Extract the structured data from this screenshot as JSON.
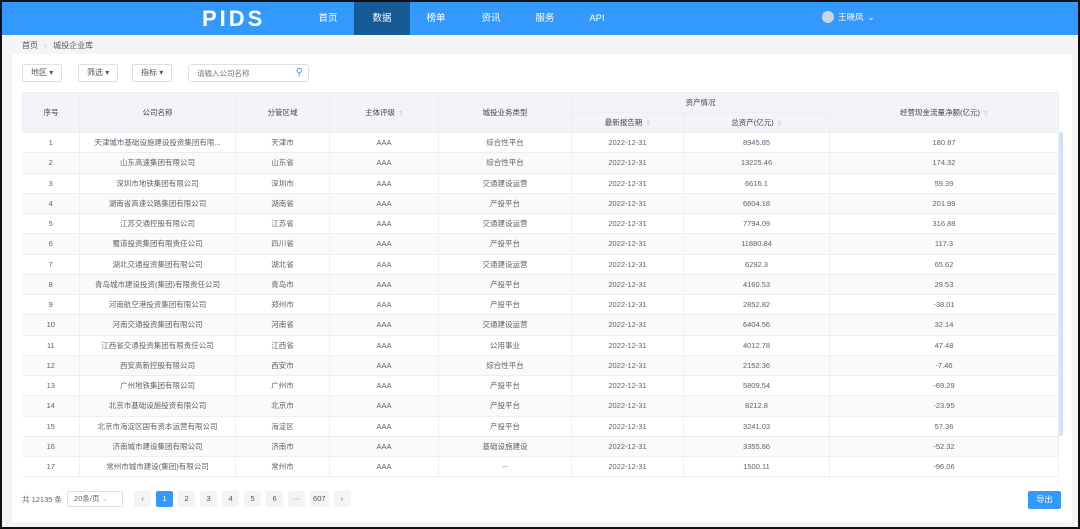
{
  "nav": {
    "logo": "PIDS",
    "items": [
      "首页",
      "数据",
      "榜单",
      "资讯",
      "服务",
      "API"
    ],
    "active": 1,
    "user": "王晓凤"
  },
  "breadcrumb": [
    "首页",
    "城投企业库"
  ],
  "filters": {
    "region": "地区",
    "screen": "筛选",
    "indicator": "指标",
    "search_placeholder": "请输入公司名称"
  },
  "table": {
    "group_header": "资产情况",
    "headers": [
      "序号",
      "公司名称",
      "分管区域",
      "主体评级",
      "城投业务类型",
      "最新报告期",
      "总资产(亿元)",
      "经营现金流量净额(亿元)"
    ],
    "rows": [
      [
        "1",
        "天津城市基础设施建设投资集团有限...",
        "天津市",
        "AAA",
        "综合性平台",
        "2022-12-31",
        "8945.85",
        "180.87"
      ],
      [
        "2",
        "山东高速集团有限公司",
        "山东省",
        "AAA",
        "综合性平台",
        "2022-12-31",
        "13225.46",
        "174.32"
      ],
      [
        "3",
        "深圳市地铁集团有限公司",
        "深圳市",
        "AAA",
        "交通建设运营",
        "2022-12-31",
        "6616.1",
        "59.39"
      ],
      [
        "4",
        "湖南省高速公路集团有限公司",
        "湖南省",
        "AAA",
        "产投平台",
        "2022-12-31",
        "6604.18",
        "201.99"
      ],
      [
        "5",
        "江苏交通控股有限公司",
        "江苏省",
        "AAA",
        "交通建设运营",
        "2022-12-31",
        "7794.09",
        "316.88"
      ],
      [
        "6",
        "蜀道投资集团有限责任公司",
        "四川省",
        "AAA",
        "产投平台",
        "2022-12-31",
        "11880.84",
        "117.3"
      ],
      [
        "7",
        "湖北交通投资集团有限公司",
        "湖北省",
        "AAA",
        "交通建设运营",
        "2022-12-31",
        "6292.3",
        "65.62"
      ],
      [
        "8",
        "青岛城市建设投资(集团)有限责任公司",
        "青岛市",
        "AAA",
        "产投平台",
        "2022-12-31",
        "4160.53",
        "29.53"
      ],
      [
        "9",
        "河南航空港投资集团有限公司",
        "郑州市",
        "AAA",
        "产投平台",
        "2022-12-31",
        "2852.82",
        "-38.01"
      ],
      [
        "10",
        "河南交通投资集团有限公司",
        "河南省",
        "AAA",
        "交通建设运营",
        "2022-12-31",
        "6404.56",
        "32.14"
      ],
      [
        "11",
        "江西省交通投资集团有限责任公司",
        "江西省",
        "AAA",
        "公用事业",
        "2022-12-31",
        "4012.78",
        "47.48"
      ],
      [
        "12",
        "西安高新控股有限公司",
        "西安市",
        "AAA",
        "综合性平台",
        "2022-12-31",
        "2152.36",
        "-7.46"
      ],
      [
        "13",
        "广州地铁集团有限公司",
        "广州市",
        "AAA",
        "产投平台",
        "2022-12-31",
        "5809.54",
        "-69.29"
      ],
      [
        "14",
        "北京市基础设施投资有限公司",
        "北京市",
        "AAA",
        "产投平台",
        "2022-12-31",
        "8212.8",
        "-23.95"
      ],
      [
        "15",
        "北京市海淀区国有资本运营有限公司",
        "海淀区",
        "AAA",
        "产投平台",
        "2022-12-31",
        "3241.03",
        "57.36"
      ],
      [
        "16",
        "济南城市建设集团有限公司",
        "济南市",
        "AAA",
        "基础设施建设",
        "2022-12-31",
        "3355.86",
        "-52.32"
      ],
      [
        "17",
        "常州市城市建设(集团)有限公司",
        "常州市",
        "AAA",
        "--",
        "2022-12-31",
        "1500.11",
        "-96.06"
      ]
    ]
  },
  "pagination": {
    "total": "共 12135 条",
    "page_size": "20条/页",
    "pages": [
      "1",
      "2",
      "3",
      "4",
      "5",
      "6",
      "···",
      "607"
    ],
    "current": "1",
    "prev": "‹",
    "next": "›"
  },
  "export_label": "导出"
}
